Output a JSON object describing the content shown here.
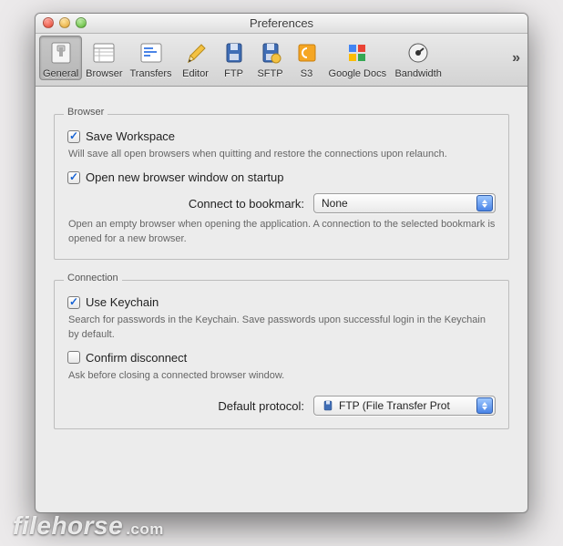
{
  "window_title": "Preferences",
  "toolbar": {
    "items": [
      {
        "label": "General"
      },
      {
        "label": "Browser"
      },
      {
        "label": "Transfers"
      },
      {
        "label": "Editor"
      },
      {
        "label": "FTP"
      },
      {
        "label": "SFTP"
      },
      {
        "label": "S3"
      },
      {
        "label": "Google Docs"
      },
      {
        "label": "Bandwidth"
      }
    ],
    "overflow_glyph": "»"
  },
  "browser_group": {
    "title": "Browser",
    "save_workspace_label": "Save Workspace",
    "save_workspace_help": "Will save all open browsers when quitting and restore the connections upon relaunch.",
    "open_new_label": "Open new browser window on startup",
    "connect_label": "Connect to bookmark:",
    "connect_value": "None",
    "connect_help": "Open an empty browser when opening the application. A connection to the selected bookmark is opened for a new browser."
  },
  "connection_group": {
    "title": "Connection",
    "use_keychain_label": "Use Keychain",
    "use_keychain_help": "Search for passwords in the Keychain. Save passwords upon successful login in the Keychain by default.",
    "confirm_disconnect_label": "Confirm disconnect",
    "confirm_disconnect_help": "Ask before closing a connected browser window.",
    "default_protocol_label": "Default protocol:",
    "default_protocol_value": "FTP (File Transfer Prot"
  },
  "watermark": {
    "brand": "filehorse",
    "suffix": ".com"
  }
}
